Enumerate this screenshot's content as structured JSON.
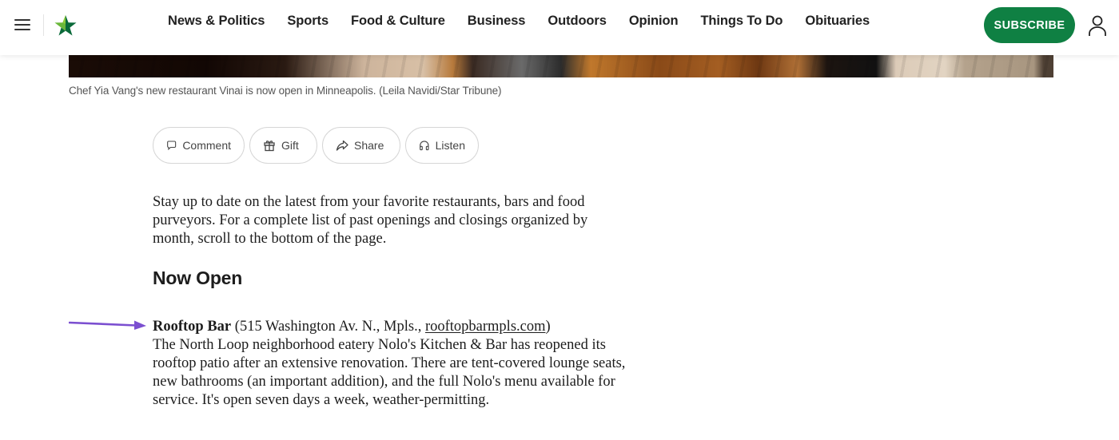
{
  "header": {
    "nav": [
      {
        "label": "News & Politics"
      },
      {
        "label": "Sports"
      },
      {
        "label": "Food & Culture"
      },
      {
        "label": "Business"
      },
      {
        "label": "Outdoors"
      },
      {
        "label": "Opinion"
      },
      {
        "label": "Things To Do"
      },
      {
        "label": "Obituaries"
      }
    ],
    "subscribe_label": "SUBSCRIBE",
    "brand_color": "#0f8043",
    "icons": {
      "menu": "hamburger-menu-icon",
      "logo": "star-tribune-star-logo",
      "account": "user-account-icon"
    }
  },
  "photo": {
    "caption": "Chef Yia Vang's new restaurant Vinai is now open in Minneapolis. (Leila Navidi/Star Tribune)"
  },
  "actions": [
    {
      "label": "Comment",
      "icon": "comment-icon"
    },
    {
      "label": "Gift",
      "icon": "gift-icon"
    },
    {
      "label": "Share",
      "icon": "share-icon"
    },
    {
      "label": "Listen",
      "icon": "headphones-icon"
    }
  ],
  "article": {
    "intro": "Stay up to date on the latest from your favorite restaurants, bars and food purveyors. For a complete list of past openings and closings organized by month, scroll to the bottom of the page.",
    "section_heading": "Now Open",
    "entries": [
      {
        "name": "Rooftop Bar",
        "address_prefix": "(515 Washington Av. N., Mpls., ",
        "link_text": "rooftopbarmpls.com",
        "address_suffix": ")",
        "body": "The North Loop neighborhood eatery Nolo's Kitchen & Bar has reopened its rooftop patio after an extensive renovation. There are tent-covered lounge seats, new bathrooms (an important addition), and the full Nolo's menu available for service. It's open seven days a week, weather-permitting."
      }
    ]
  },
  "annotation": {
    "arrow_color": "#7b4fd0",
    "arrow_target": "Rooftop Bar"
  }
}
